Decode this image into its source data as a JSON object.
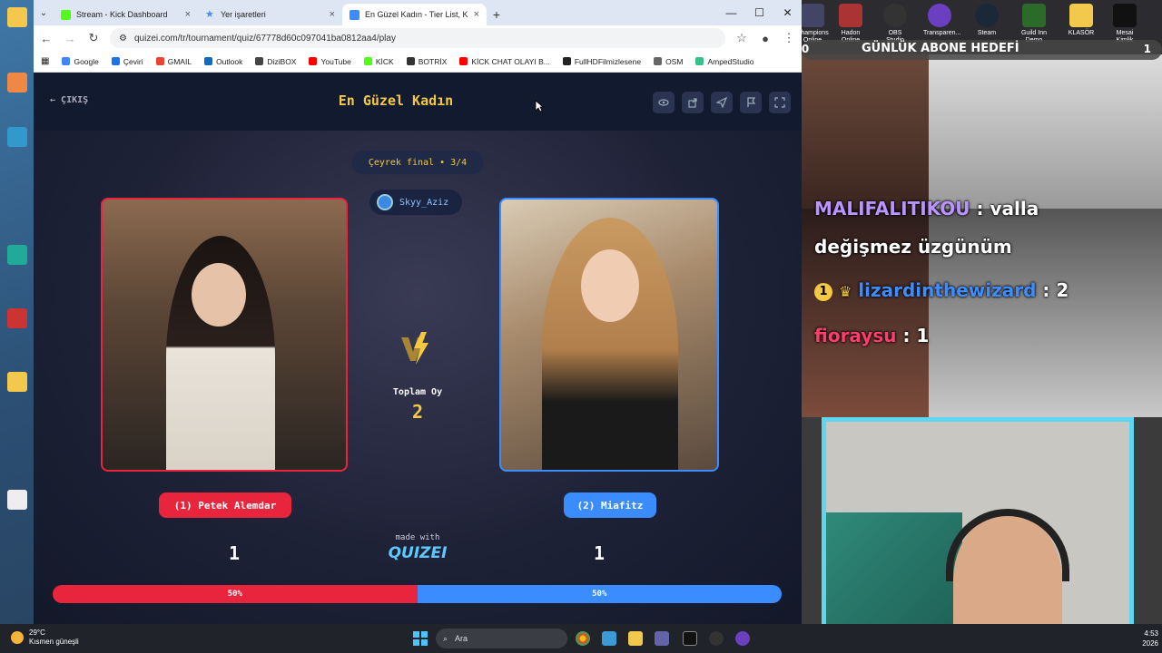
{
  "browser": {
    "tabs": [
      {
        "title": "Stream - Kick Dashboard",
        "color": "#53fc18"
      },
      {
        "title": "Yer işaretleri",
        "color": "#4a8af4"
      },
      {
        "title": "En Güzel Kadın - Tier List, Kör S",
        "color": "#3b8cff"
      }
    ],
    "url": "quizei.com/tr/tournament/quiz/67778d60c097041ba0812aa4/play",
    "bookmarks": [
      {
        "label": "Google",
        "color": "#4285f4"
      },
      {
        "label": "Çeviri",
        "color": "#1a73e8"
      },
      {
        "label": "GMAIL",
        "color": "#ea4335"
      },
      {
        "label": "Outlook",
        "color": "#0f6cbd"
      },
      {
        "label": "DiziBOX",
        "color": "#444"
      },
      {
        "label": "YouTube",
        "color": "#ff0000"
      },
      {
        "label": "KİCK",
        "color": "#53fc18"
      },
      {
        "label": "BOTRİX",
        "color": "#333"
      },
      {
        "label": "KİCK CHAT OLAYI B...",
        "color": "#ff0000"
      },
      {
        "label": "FullHDFilmizlesene",
        "color": "#222"
      },
      {
        "label": "OSM",
        "color": "#666"
      },
      {
        "label": "AmpedStudio",
        "color": "#39c08a"
      }
    ]
  },
  "quiz": {
    "exit_label": "ÇIKIŞ",
    "title": "En Güzel Kadın",
    "round": "Çeyrek final • 3/4",
    "username": "Skyy_Aziz",
    "total_label": "Toplam Oy",
    "total_votes": "2",
    "left": {
      "name": "(1) Petek Alemdar",
      "score": "1",
      "percent": "50%",
      "share": 0.5
    },
    "right": {
      "name": "(2) Miafitz",
      "score": "1",
      "percent": "50%",
      "share": 0.5
    },
    "made_with": "made with",
    "logo": "QUIZEI"
  },
  "overlay": {
    "taskbar_icons": [
      {
        "label": "Champions Online",
        "color": "#446"
      },
      {
        "label": "Hadon Online",
        "color": "#a33"
      },
      {
        "label": "OBS Studio",
        "color": "#333"
      },
      {
        "label": "Transparen...",
        "color": "#6a3fc0"
      },
      {
        "label": "Steam",
        "color": "#1b2838"
      },
      {
        "label": "Guild Inn Demo",
        "color": "#2c6a2a"
      },
      {
        "label": "KLASÖR",
        "color": "#f2c94c"
      },
      {
        "label": "Mesai Kimlik",
        "color": "#111"
      }
    ],
    "goal": {
      "left_count": "0",
      "title": "GÜNLÜK ABONE HEDEFİ",
      "right_count": "1"
    },
    "chat": [
      {
        "user": "MALIFALITIKOU",
        "text": ": valla",
        "color": "#b993ff"
      },
      {
        "user": "",
        "text": "değişmez üzgünüm",
        "color": "#ffffff"
      },
      {
        "user": "lizardinthewizard",
        "text": ": 2",
        "color": "#3f8cff",
        "badge": "1"
      },
      {
        "user": "fioraysu",
        "text": ": 1",
        "color": "#ff3c6c"
      }
    ]
  },
  "taskbar": {
    "temp": "29°C",
    "weather": "Kısmen güneşli",
    "search": "Ara",
    "time": "4:53",
    "year": "2026"
  }
}
